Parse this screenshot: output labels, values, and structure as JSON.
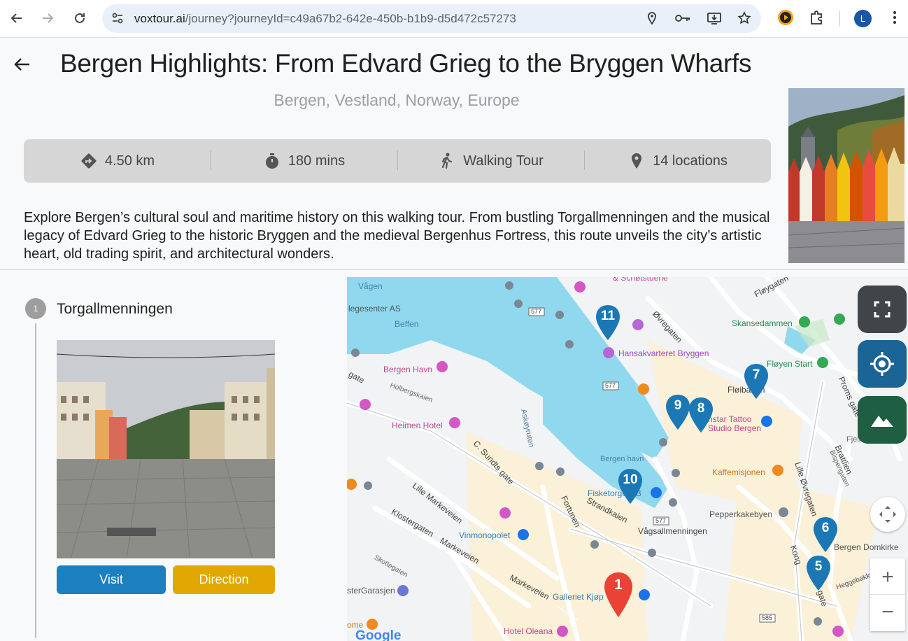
{
  "browser": {
    "url_host": "voxtour.ai",
    "url_rest": "/journey?journeyId=c49a67b2-642e-450b-b1b9-d5d472c57273",
    "profile_initial": "L"
  },
  "header": {
    "title": "Bergen Highlights: From Edvard Grieg to the Bryggen Wharfs",
    "location": "Bergen, Vestland, Norway, Europe"
  },
  "stats": [
    {
      "icon": "directions-icon",
      "label": "4.50 km"
    },
    {
      "icon": "timer-icon",
      "label": "180 mins"
    },
    {
      "icon": "walking-icon",
      "label": "Walking Tour"
    },
    {
      "icon": "location-pin-icon",
      "label": "14 locations"
    }
  ],
  "description": "Explore Bergen’s cultural soul and maritime history on this walking tour. From bustling Torgallmenningen and the musical legacy of Edvard Grieg to the historic Bryggen and the medieval Bergenhus Fortress, this route unveils the city’s artistic heart, old trading spirit, and architectural wonders.",
  "stop": {
    "number": "1",
    "name": "Torgallmenningen",
    "visit_label": "Visit",
    "direction_label": "Direction"
  },
  "map": {
    "labels": {
      "vagen": "Vågen",
      "legesenter": "legesenter AS",
      "beffen": "Beffen",
      "bergen_havn_top": "Bergen Havn",
      "heimen": "Heimen Hotel",
      "holbergskaien": "Holbergskaien",
      "gate": "gate",
      "c_sundts": "C. Sundts gate",
      "lille_markeveien": "Lille Markeveien",
      "klostergaten": "Klostergaten",
      "skottegaten": "Skottegaten",
      "markeveien": "Markeveien",
      "markeveien2": "Markeveien",
      "vinmonopolet": "Vinmonopolet",
      "garasjen": "sterGarasjen",
      "galleriet": "Galleriet Kjøp",
      "oleana": "Hotel Oleana",
      "fisketorget": "Fisketorget i B",
      "bergen_havn": "Bergen havn",
      "strandkaien": "Strandkaien",
      "vagsallmenningen": "Vågsallmenningen",
      "fortunen": "Fortunen",
      "askoyruten": "Askøyruten",
      "schotstuene": "& Schøtstuene",
      "hansakvarteret": "Hansakvarteret Bryggen",
      "oevregaten": "Øvregaten",
      "floybanen": "Fløibanen",
      "tattoo1": "nstar Tattoo",
      "tattoo2": "Studio Bergen",
      "floyen": "Fløyen Start",
      "skansedammen": "Skansedammen",
      "kaffemisjonen": "Kaffemisjonen",
      "pepperkakebyen": "Pepperkakebyen",
      "domkirke": "Bergen Domkirke",
      "lille_ovregaten": "Lille Øvregaten",
      "kong": "Kong",
      "gate2": "gate",
      "proms": "Proms gate",
      "floygaten": "Fløygaten",
      "fjellveien": "Fjellveien",
      "brattlien": "Brattlien",
      "bispengaten": "Bispengaten",
      "heggebak": "Heggebakken",
      "ome": "ome",
      "route577a": "577",
      "route577b": "577",
      "route577c": "577",
      "route585": "585",
      "google": "Google"
    },
    "markers": [
      "1",
      "5",
      "6",
      "7",
      "8",
      "9",
      "10",
      "11"
    ],
    "zoom_in": "+",
    "zoom_out": "−"
  },
  "colors": {
    "visit": "#1b7fc0",
    "direction": "#e0a800",
    "marker_blue": "#1b78b4",
    "marker_red": "#ea4335"
  }
}
